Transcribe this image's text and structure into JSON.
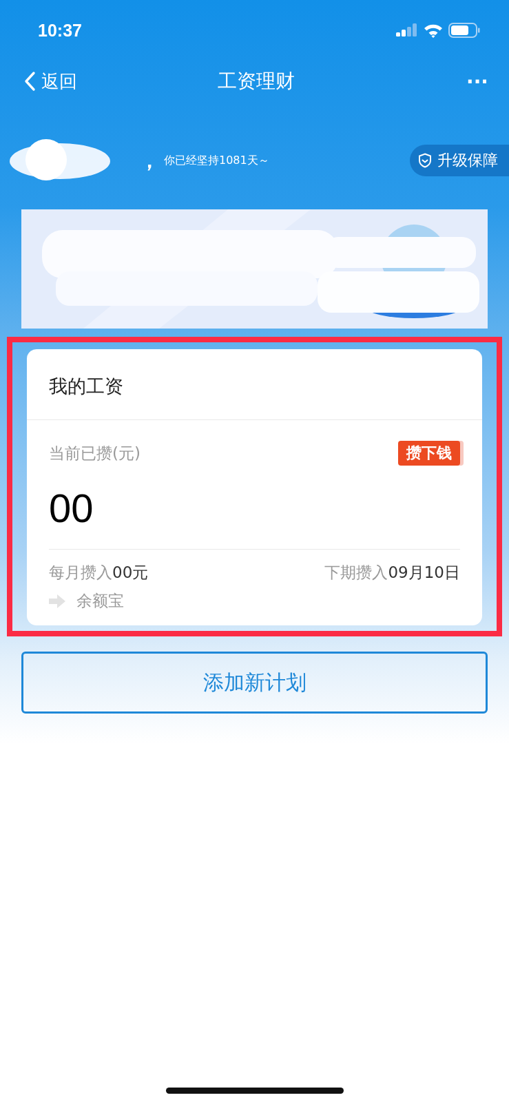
{
  "status_bar": {
    "time": "10:37"
  },
  "nav": {
    "back": "返回",
    "title": "工资理财",
    "more": "···"
  },
  "greeting": {
    "suffix": "，",
    "streak": "你已经坚持1081天～",
    "upgrade": "升级保障"
  },
  "highlight": true,
  "card": {
    "title": "我的工资",
    "saved_label": "当前已攒(元)",
    "tag": "攒下钱",
    "amount": "00",
    "monthly_label": "每月攒入",
    "monthly_value": "00元",
    "next_label": "下期攒入",
    "next_value": "09月10日",
    "destination": "余额宝"
  },
  "add_button": "添加新计划"
}
